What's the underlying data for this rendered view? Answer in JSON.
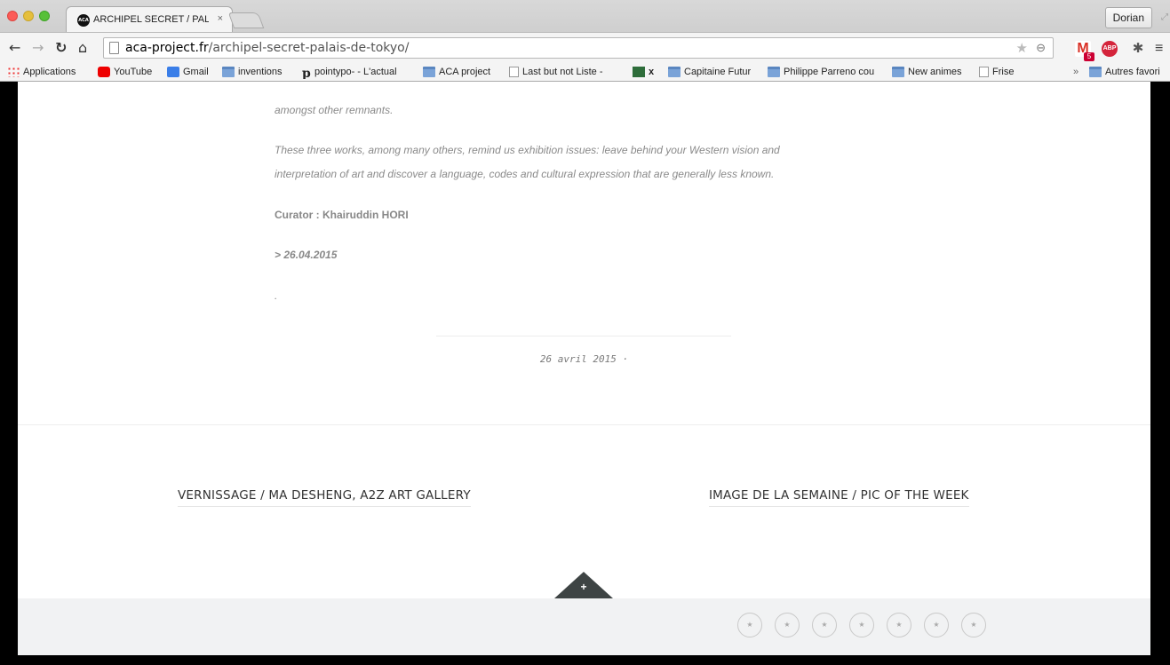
{
  "browser": {
    "tab_title": "ARCHIPEL SECRET / PALAIS",
    "tab_favicon_text": "ACA",
    "tab_close": "×",
    "profile_name": "Dorian",
    "url_host": "aca-project.fr",
    "url_path": "/archipel-secret-palais-de-tokyo/",
    "gmail_count": "5",
    "abp_label": "ABP",
    "bookmarks": [
      {
        "label": "Applications",
        "icon": "apps-grid-icon"
      },
      {
        "label": "YouTube",
        "icon": "youtube-icon"
      },
      {
        "label": "Gmail",
        "icon": "google-icon"
      },
      {
        "label": "inventions",
        "icon": "folder-icon"
      },
      {
        "label": "pointypo- - L'actual",
        "icon": "pointypo-icon"
      },
      {
        "label": "ACA project",
        "icon": "folder-icon"
      },
      {
        "label": "Last but not Liste -",
        "icon": "page-icon"
      },
      {
        "label": "x",
        "icon": "green-square-icon"
      },
      {
        "label": "Capitaine Futur",
        "icon": "folder-icon"
      },
      {
        "label": "Philippe Parreno cou",
        "icon": "folder-icon"
      },
      {
        "label": "New animes",
        "icon": "folder-icon"
      },
      {
        "label": "Frise",
        "icon": "page-icon"
      }
    ],
    "bookmarks_overflow": "»",
    "bookmarks_other": "Autres favori"
  },
  "article": {
    "line1": "amongst other remnants.",
    "line2": "These three works, among many others, remind us exhibition issues: leave behind your Western vision and",
    "line3": "interpretation of art and discover a language, codes and cultural expression that are generally less known.",
    "curator": "Curator : Khairuddin HORI",
    "end_date": "> 26.04.2015",
    "dot": "."
  },
  "post_meta": {
    "date": "26 avril 2015 ·"
  },
  "post_navigation": {
    "previous": "VERNISSAGE / MA DESHENG, A2Z ART GALLERY",
    "next": "IMAGE DE LA SEMAINE / PIC OF THE WEEK"
  },
  "footer": {
    "toggle_label": "+",
    "social_icon_glyph": "★",
    "social_icon_count": 7
  }
}
